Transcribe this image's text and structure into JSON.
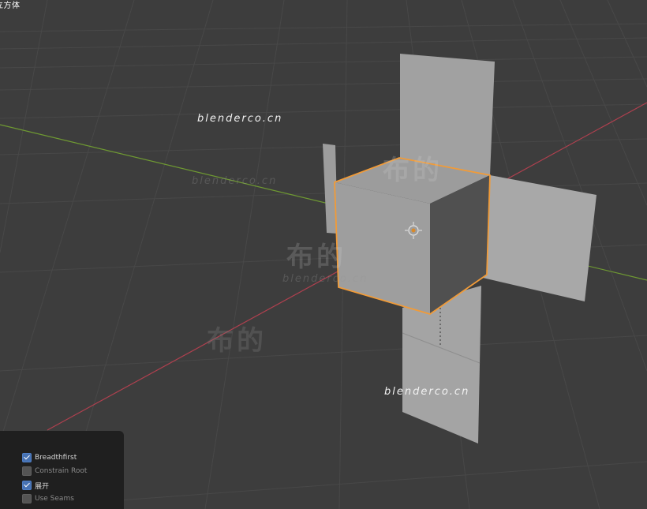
{
  "viewport": {
    "object_name": "立方体",
    "watermarks": {
      "site_top": "blenderco.cn",
      "site_bottom": "blenderco.cn",
      "site_faint_1": "blenderco.cn",
      "site_faint_2": "blenderco.cn",
      "cn_1": "布的",
      "cn_2": "布的",
      "cn_3": "布的"
    }
  },
  "operator_panel": {
    "options": [
      {
        "label": "Breadthfirst",
        "checked": true
      },
      {
        "label": "Constrain Root",
        "checked": false
      },
      {
        "label": "展开",
        "checked": true
      },
      {
        "label": "Use Seams",
        "checked": false
      }
    ]
  },
  "colors": {
    "background": "#3d3d3d",
    "grid": "#484848",
    "x_axis": "#b0404f",
    "y_axis": "#6f9a32",
    "selection_outline": "#f19b38",
    "plane_gray": "#a3a3a3",
    "checkbox_on": "#4772b3"
  }
}
